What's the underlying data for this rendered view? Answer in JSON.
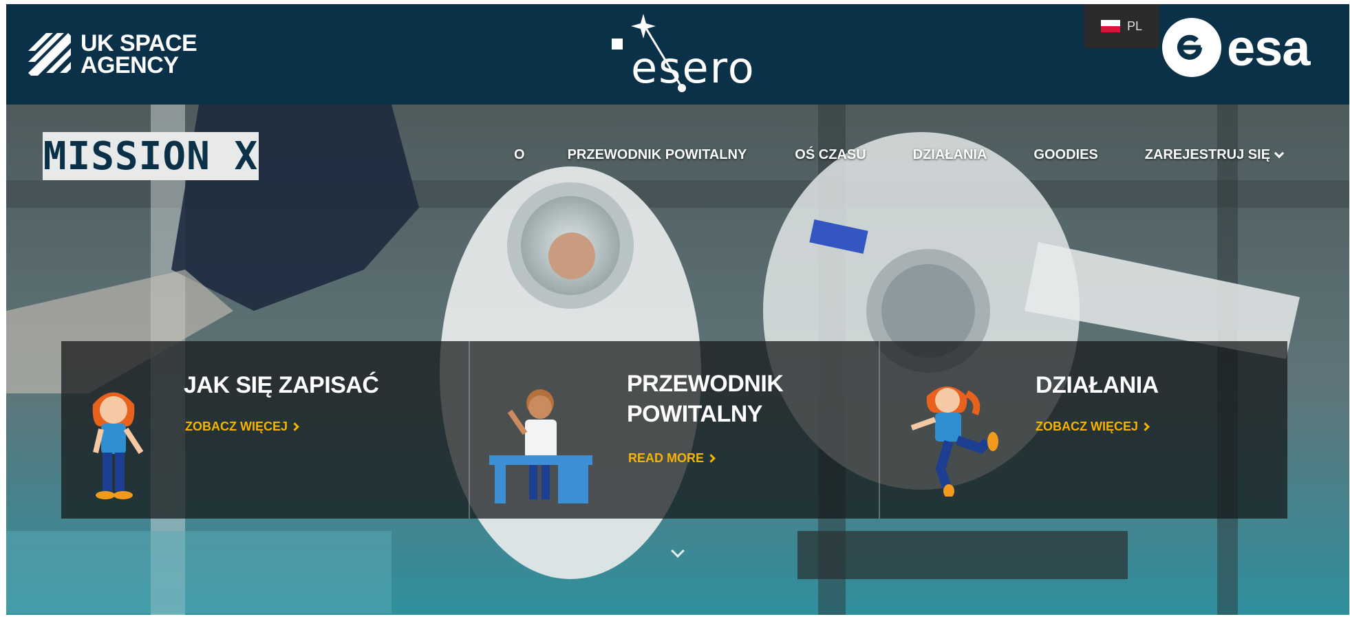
{
  "header": {
    "uk_space_agency_line1": "UK SPACE",
    "uk_space_agency_line2": "AGENCY",
    "esero_logo_text": "esero",
    "language": "PL",
    "esa_logo_text": "esa"
  },
  "brand": {
    "mission_x": "MISSION X"
  },
  "nav": {
    "items": [
      {
        "label": "O"
      },
      {
        "label": "PRZEWODNIK POWITALNY"
      },
      {
        "label": "OŚ CZASU"
      },
      {
        "label": "DZIAŁANIA"
      },
      {
        "label": "GOODIES"
      },
      {
        "label": "ZAREJESTRUJ SIĘ"
      }
    ]
  },
  "cards": [
    {
      "title": "JAK SIĘ ZAPISAĆ",
      "link": "ZOBACZ WIĘCEJ"
    },
    {
      "title_line1": "PRZEWODNIK",
      "title_line2": "POWITALNY",
      "link": "READ MORE"
    },
    {
      "title": "DZIAŁANIA",
      "link": "ZOBACZ WIĘCEJ"
    }
  ],
  "colors": {
    "header_bg": "#0a3148",
    "link_accent": "#f5b400",
    "card_bg": "rgba(20,22,24,0.72)"
  },
  "icons": {
    "language_flag": "poland-flag-icon",
    "nav_dropdown": "chevron-down-icon",
    "card_link": "chevron-right-icon",
    "scroll": "chevron-down-icon"
  }
}
